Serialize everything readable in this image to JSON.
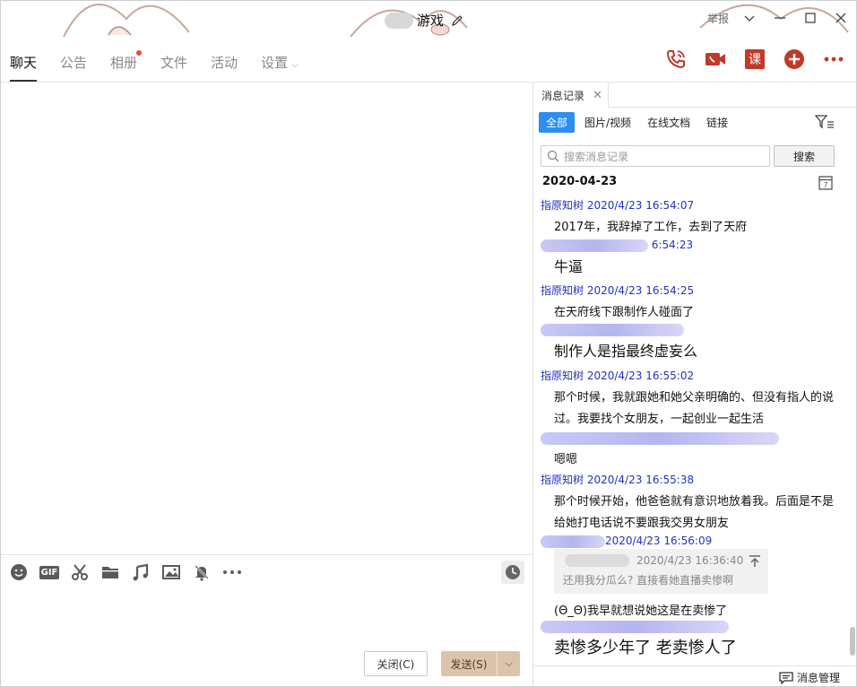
{
  "window": {
    "title": "游戏",
    "report": "举报",
    "colors": {
      "accent": "#2b8ef0",
      "icon_red": "#c0392b",
      "send_bg": "#dcc4aa",
      "sender_blue": "#2233bb"
    }
  },
  "tabs": [
    {
      "label": "聊天",
      "active": true
    },
    {
      "label": "公告"
    },
    {
      "label": "相册",
      "badge": true
    },
    {
      "label": "文件"
    },
    {
      "label": "活动"
    },
    {
      "label": "设置"
    }
  ],
  "actions": [
    "phone-icon",
    "video-call-icon",
    "course-icon",
    "add-icon",
    "more-icon"
  ],
  "course_label": "课",
  "toolbar_icons": [
    "emoji-icon",
    "gif-icon",
    "scissors-icon",
    "folder-icon",
    "music-icon",
    "image-icon",
    "mute-bell-icon",
    "more-icon"
  ],
  "gif_label": "GIF",
  "buttons": {
    "close": "关闭(C)",
    "send": "发送(S)"
  },
  "history": {
    "tab_label": "消息记录",
    "filters": [
      "全部",
      "图片/视频",
      "在线文档",
      "链接"
    ],
    "search_placeholder": "搜索消息记录",
    "search_button": "搜索",
    "date": "2020-04-23",
    "messages": [
      {
        "sender": "指原知树",
        "time": "2020/4/23 16:54:07",
        "text": "2017年，我辞掉了工作，去到了天府"
      },
      {
        "sender": "",
        "time": "6:54:23",
        "text": "牛逼"
      },
      {
        "sender": "指原知树",
        "time": "2020/4/23 16:54:25",
        "text": "在天府线下跟制作人碰面了"
      },
      {
        "sender": "",
        "time": "",
        "text": "制作人是指最终虚妄么"
      },
      {
        "sender": "指原知树",
        "time": "2020/4/23 16:55:02",
        "text": "那个时候，我就跟她和她父亲明确的、但没有指人的说过。我要找个女朋友，一起创业一起生活"
      },
      {
        "sender": "",
        "time": "",
        "text": "嗯嗯"
      },
      {
        "sender": "指原知树",
        "time": "2020/4/23 16:55:38",
        "text": "那个时候开始，他爸爸就有意识地放着我。后面是不是给她打电话说不要跟我交男女朋友"
      },
      {
        "sender": "",
        "time": "2020/4/23 16:56:09",
        "text": "(Θ_Θ)我早就想说她这是在卖惨了"
      },
      {
        "sender": "",
        "time": "",
        "text": "卖惨多少年了 老卖惨人了"
      }
    ],
    "quote": {
      "time": "2020/4/23 16:36:40",
      "text": "还用我分瓜么? 直接看她直播卖惨啊"
    },
    "manage_label": "消息管理"
  }
}
